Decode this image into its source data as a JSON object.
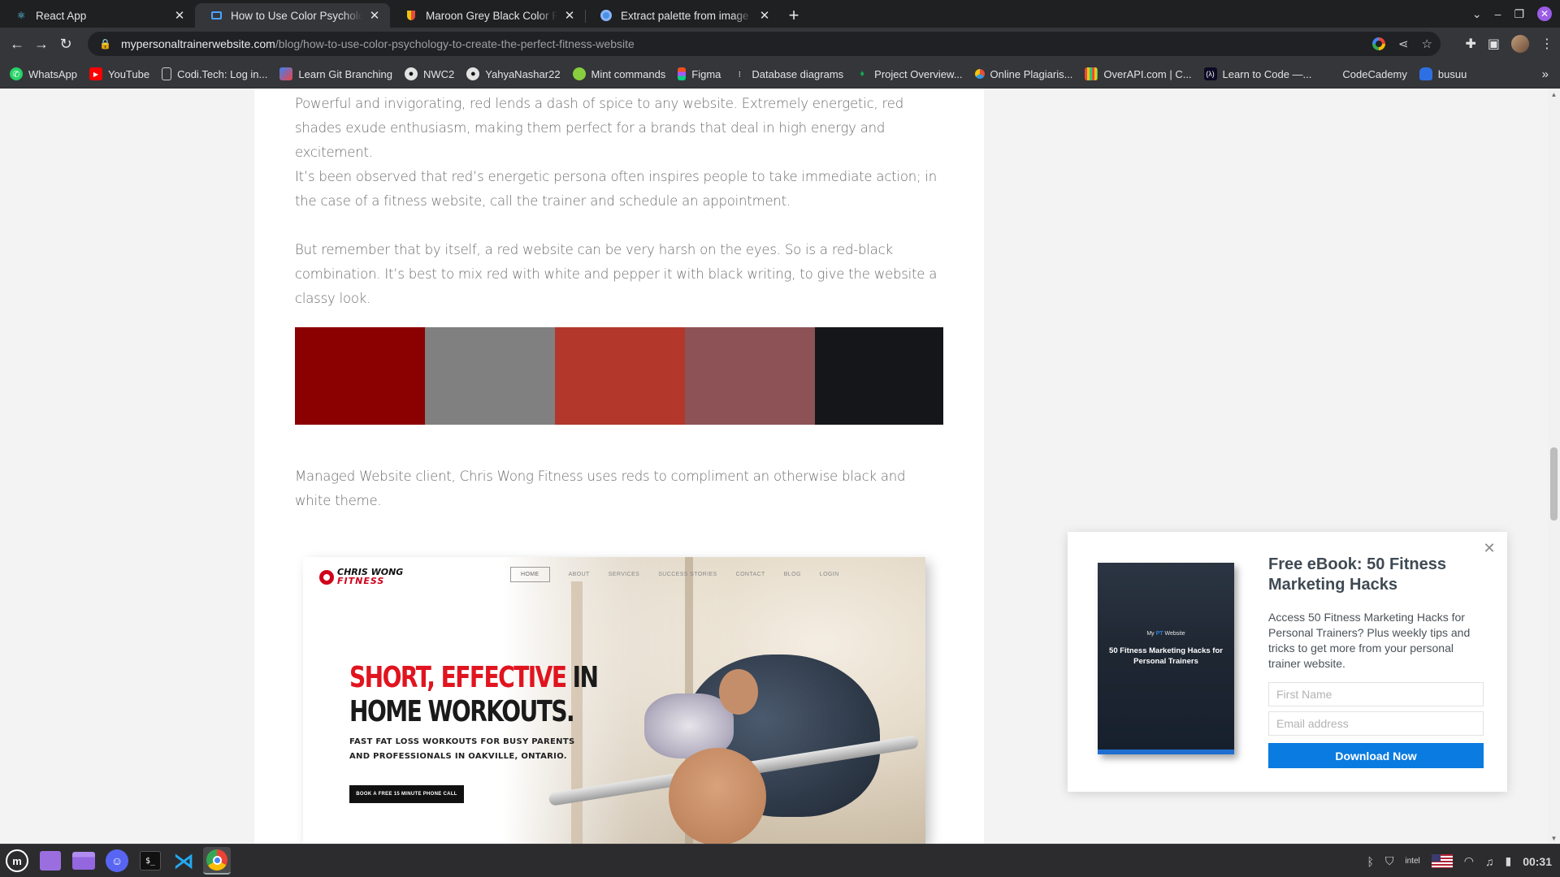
{
  "browser": {
    "tabs": [
      {
        "title": "React App",
        "icon": "react-icon",
        "active": false
      },
      {
        "title": "How to Use Color Psychology",
        "icon": "site-icon",
        "active": true
      },
      {
        "title": "Maroon Grey Black Color Pal",
        "icon": "palette-site-icon",
        "active": false
      },
      {
        "title": "Extract palette from image -",
        "icon": "chrome-icon",
        "active": false
      }
    ],
    "new_tab": "+",
    "url_host": "mypersonaltrainerwebsite.com",
    "url_path": "/blog/how-to-use-color-psychology-to-create-the-perfect-fitness-website",
    "bookmarks": [
      {
        "label": "WhatsApp",
        "icon": "whatsapp-icon"
      },
      {
        "label": "YouTube",
        "icon": "youtube-icon"
      },
      {
        "label": "Codi.Tech: Log in...",
        "icon": "doc-icon"
      },
      {
        "label": "Learn Git Branching",
        "icon": "git-icon"
      },
      {
        "label": "NWC2",
        "icon": "github-icon"
      },
      {
        "label": "YahyaNashar22",
        "icon": "github-icon"
      },
      {
        "label": "Mint commands",
        "icon": "mint-icon"
      },
      {
        "label": "Figma",
        "icon": "figma-icon"
      },
      {
        "label": "Database diagrams",
        "icon": "dbdiagram-icon"
      },
      {
        "label": "Project Overview...",
        "icon": "mongodb-icon"
      },
      {
        "label": "Online Plagiaris...",
        "icon": "plagiarism-icon"
      },
      {
        "label": "OverAPI.com | C...",
        "icon": "overapi-icon"
      },
      {
        "label": "Learn to Code —...",
        "icon": "freecodecamp-icon"
      },
      {
        "label": "CodeCademy",
        "icon": "codecademy-icon"
      },
      {
        "label": "busuu",
        "icon": "busuu-icon"
      }
    ],
    "bookmarks_more": "»"
  },
  "article": {
    "paragraphs": [
      "Powerful and invigorating, red lends a dash of spice to any website. Extremely energetic, red shades exude enthusiasm, making them perfect for a brands that deal in high energy and excitement.",
      "It’s been observed that red’s energetic persona often inspires people to take immediate action; in the case of a fitness website, call the trainer and schedule an appointment.",
      "But remember that by itself, a red website can be very harsh on the eyes. So is a red-black combination. It’s best to mix red with white and pepper it with black writing, to give the website a classy look.",
      "Managed Website client, Chris Wong Fitness uses reds to compliment an otherwise black and white theme."
    ],
    "palette": [
      "#8b0000",
      "#808080",
      "#b3372b",
      "#8d5255",
      "#15161a"
    ],
    "screenshot": {
      "logo_line1": "CHRIS WONG",
      "logo_line2": "FITNESS",
      "nav": [
        "HOME",
        "ABOUT",
        "SERVICES",
        "SUCCESS STORIES",
        "CONTACT",
        "BLOG",
        "LOGIN"
      ],
      "headline_red": "SHORT, EFFECTIVE",
      "headline_dark_1": " IN",
      "headline_dark_2": "HOME WORKOUTS.",
      "subheadline": "FAST FAT LOSS WORKOUTS FOR BUSY PARENTS AND PROFESSIONALS IN OAKVILLE, ONTARIO.",
      "cta": "BOOK A FREE 15 MINUTE PHONE CALL"
    }
  },
  "popup": {
    "title": "Free eBook: 50 Fitness Marketing Hacks",
    "description": "Access 50 Fitness Marketing Hacks for Personal Trainers? Plus weekly tips and tricks to get more from your personal trainer website.",
    "first_name_placeholder": "First Name",
    "email_placeholder": "Email address",
    "button": "Download Now",
    "book_brand_1": "My ",
    "book_brand_2": "PT",
    "book_brand_3": " Website",
    "book_title": "50 Fitness Marketing Hacks for Personal Trainers"
  },
  "taskbar": {
    "apps": [
      "mint-menu-icon",
      "workspace-icon",
      "files-icon",
      "discord-icon",
      "terminal-icon",
      "vscode-icon",
      "chrome-icon"
    ],
    "clock": "00:31"
  }
}
